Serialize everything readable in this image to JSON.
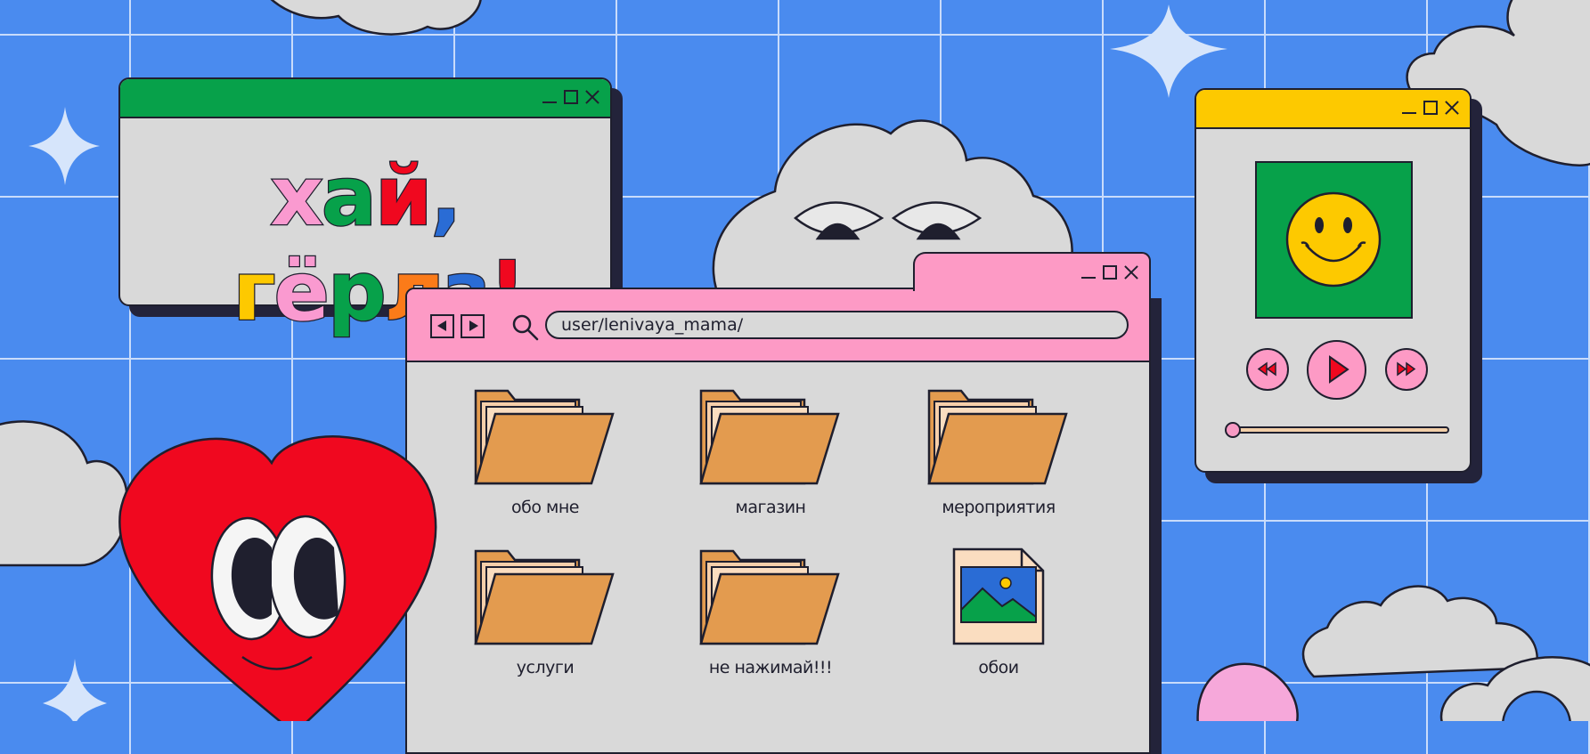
{
  "greeting_window": {
    "greeting": [
      "х",
      "а",
      "й",
      ",",
      " ",
      "г",
      "ё",
      "р",
      "л",
      "з",
      "!"
    ],
    "greeting_colors": [
      "#fa9ad0",
      "#07a14a",
      "#f0081f",
      "#2a6cd5",
      "",
      "#fdc900",
      "#fa9ad0",
      "#07a14a",
      "#fb7b19",
      "#2a6cd5",
      "#f0081f"
    ]
  },
  "browser": {
    "address": "user/lenivaya_mama/",
    "folders": [
      {
        "label": "обо мне",
        "icon": "folder-icon"
      },
      {
        "label": "магазин",
        "icon": "folder-icon"
      },
      {
        "label": "мероприятия",
        "icon": "folder-icon"
      },
      {
        "label": "услуги",
        "icon": "folder-icon"
      },
      {
        "label": "не нажимай!!!",
        "icon": "folder-icon"
      },
      {
        "label": "обои",
        "icon": "image-file-icon"
      }
    ]
  },
  "player": {
    "track_progress": 0.02
  },
  "colors": {
    "background": "#4a8bef",
    "grid": "#c9dcfb",
    "window": "#d9d9d9",
    "outline": "#1f1f2e",
    "green": "#07a14a",
    "pink": "#fd9ac5",
    "yellow": "#fdc900",
    "red": "#f0081f",
    "folder": "#e39b4f"
  }
}
